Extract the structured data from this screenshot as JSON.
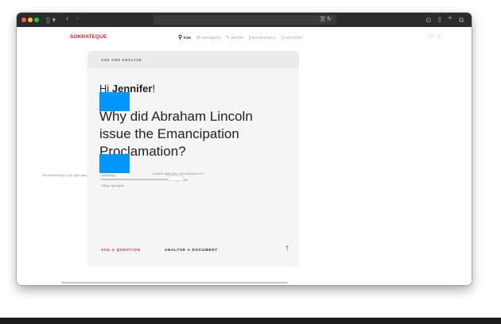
{
  "browser": {
    "icons": {
      "sidebar": "sidebar-icon",
      "back": "back-icon",
      "forward": "forward-icon",
      "translate": "translate-icon",
      "reload": "reload-icon",
      "downloads": "downloads-icon",
      "share": "share-icon",
      "new_tab": "plus-icon",
      "tabs": "tabs-icon"
    }
  },
  "app": {
    "logo": "SOKRATEQUE",
    "nav": [
      {
        "label": "ASK",
        "icon": "search-icon",
        "active": true
      },
      {
        "label": "ANSWERS",
        "icon": "answers-icon",
        "active": false
      },
      {
        "label": "WRITE",
        "icon": "write-icon",
        "active": false
      },
      {
        "label": "BOOKSHELF",
        "icon": "bookmark-icon",
        "active": false
      },
      {
        "label": "HISTORY",
        "icon": "history-icon",
        "active": false
      }
    ],
    "accent_color": "#d81e2c"
  },
  "card": {
    "header": "ASK AND ANALYSE",
    "greeting_prefix": "Hi ",
    "greeting_name": "Jennifer",
    "greeting_suffix": "!",
    "question": "Why did Abraham Lincoln issue the Emancipation Proclamation?",
    "annotations": {
      "hint_left": "Hill Grotesk light 12pt, light grey",
      "placeholder": "Analysing...",
      "outline": "Outline: light grey, line thickness 0.5",
      "filling_white": "Filling: white",
      "filling_grey": "Filling: light grey"
    },
    "footer": {
      "ask_label": "ASK A QUESTION",
      "analyse_label": "ANALYSE A DOCUMENT",
      "send_icon": "arrow-up-icon"
    }
  }
}
